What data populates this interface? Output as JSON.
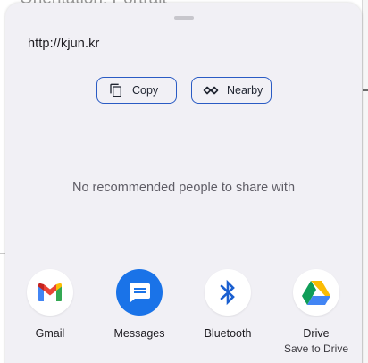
{
  "background": {
    "app_text": "Orientation: Portrait"
  },
  "sheet": {
    "shared_text": "http://kjun.kr",
    "actions": {
      "copy_label": "Copy",
      "nearby_label": "Nearby"
    },
    "empty_message": "No recommended people to share with",
    "apps": [
      {
        "label": "Gmail",
        "icon": "gmail-icon"
      },
      {
        "label": "Messages",
        "icon": "messages-icon"
      },
      {
        "label": "Bluetooth",
        "icon": "bluetooth-icon"
      },
      {
        "label": "Drive",
        "sublabel": "Save to Drive",
        "icon": "drive-icon"
      }
    ]
  },
  "colors": {
    "sheet_bg": "#f1f0f5",
    "chip_border": "#2a5bc4",
    "messages_blue": "#1a73e8",
    "bluetooth_blue": "#1a5fd0"
  }
}
